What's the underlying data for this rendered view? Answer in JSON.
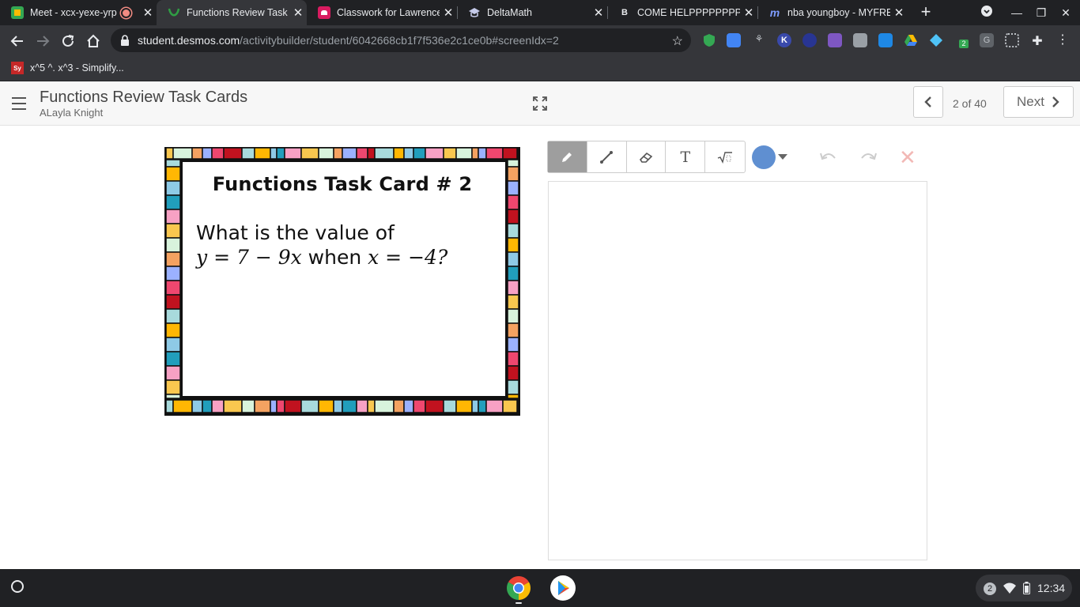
{
  "browser": {
    "tabs": [
      {
        "title": "Meet - xcx-yexe-yrp",
        "favicon": "google-meet-icon",
        "recording": true
      },
      {
        "title": "Functions Review Task",
        "favicon": "desmos-icon",
        "active": true
      },
      {
        "title": "Classwork for Lawrence",
        "favicon": "google-classroom-icon"
      },
      {
        "title": "DeltaMath",
        "favicon": "deltamath-icon"
      },
      {
        "title": "COME HELPPPPPPPPP",
        "favicon": "brainly-icon"
      },
      {
        "title": "nba youngboy - MYFRE",
        "favicon": "myfreemp3-icon"
      }
    ],
    "url_host": "student.desmos.com",
    "url_path": "/activitybuilder/student/6042668cb1f7f536e2c1ce0b#screenIdx=2",
    "bookmark": {
      "icon_text": "Sy",
      "label": "x^5 ^. x^3 - Simplify..."
    },
    "extension_badge": "2",
    "colors": {
      "frame": "#202124",
      "toolbar": "#35363a",
      "text": "#e8eaed"
    }
  },
  "header": {
    "activity_title": "Functions Review Task Cards",
    "student_name": "ALayla Knight",
    "page_count": "2 of 40",
    "next_label": "Next"
  },
  "card": {
    "title": "Functions Task Card # 2",
    "question_line1": "What is the value of",
    "question_line2_math_a": "y = 7 − 9x",
    "question_line2_text": " when ",
    "question_line2_math_b": "x = −4?"
  },
  "sketch": {
    "tools": [
      "pencil-icon",
      "line-icon",
      "eraser-icon",
      "text-icon",
      "math-icon"
    ],
    "text_tool_label": "T",
    "pen_color": "#5f8fd1"
  },
  "shelf": {
    "notification_count": "2",
    "time": "12:34"
  }
}
